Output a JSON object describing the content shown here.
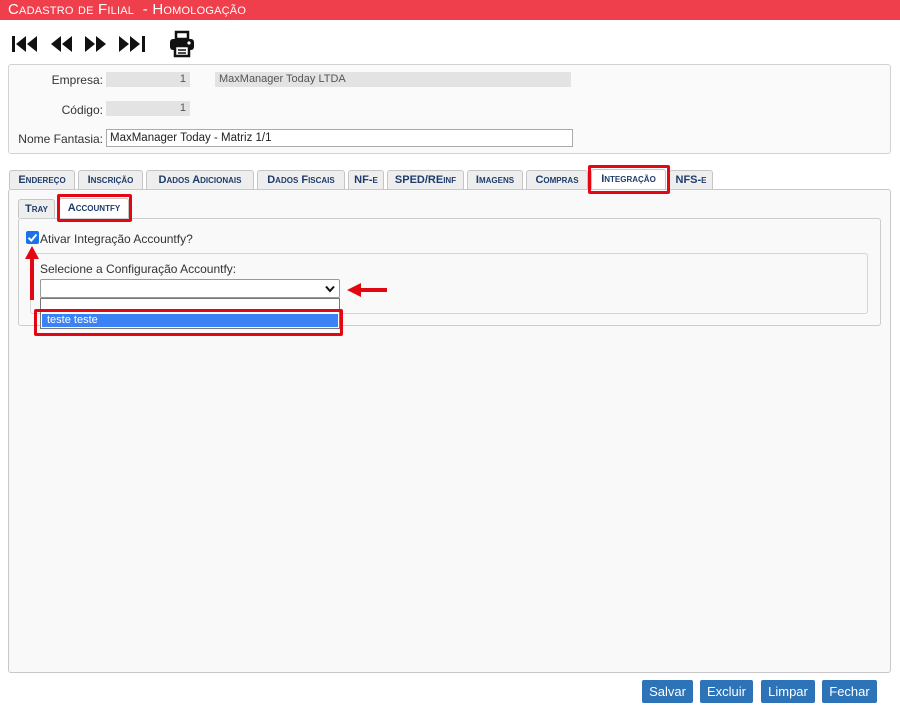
{
  "window": {
    "title": "Cadastro de Filial  - Homologação"
  },
  "toolbar": {
    "icons": [
      "first-record-icon",
      "previous-record-icon",
      "next-record-icon",
      "last-record-icon",
      "print-icon"
    ]
  },
  "form": {
    "empresa_label": "Empresa:",
    "empresa_code": "1",
    "empresa_name": "MaxManager Today LTDA",
    "codigo_label": "Código:",
    "codigo_value": "1",
    "nome_fantasia_label": "Nome Fantasia:",
    "nome_fantasia_value": "MaxManager Today - Matriz 1/1"
  },
  "tabs": [
    "Endereço",
    "Inscrição",
    "Dados Adicionais",
    "Dados Fiscais",
    "NF-e",
    "SPED/REinf",
    "Imagens",
    "Compras",
    "Integração",
    "NFS-e"
  ],
  "active_tab": "Integração",
  "subtabs": [
    "Tray",
    "Accountfy"
  ],
  "active_subtab": "Accountfy",
  "integration": {
    "checkbox_label": "Ativar Integração Accountfy?",
    "checked": true,
    "config_label": "Selecione a Configuração Accountfy:",
    "selected_value": "",
    "options": [
      "",
      "teste teste"
    ],
    "highlighted_option": "teste teste"
  },
  "buttons": {
    "save": "Salvar",
    "delete": "Excluir",
    "clear": "Limpar",
    "close": "Fechar"
  },
  "colors": {
    "title_bar": "#ef3f4c",
    "button": "#2c73b7",
    "annotation": "#e30613",
    "option_highlight": "#3b82f6"
  }
}
